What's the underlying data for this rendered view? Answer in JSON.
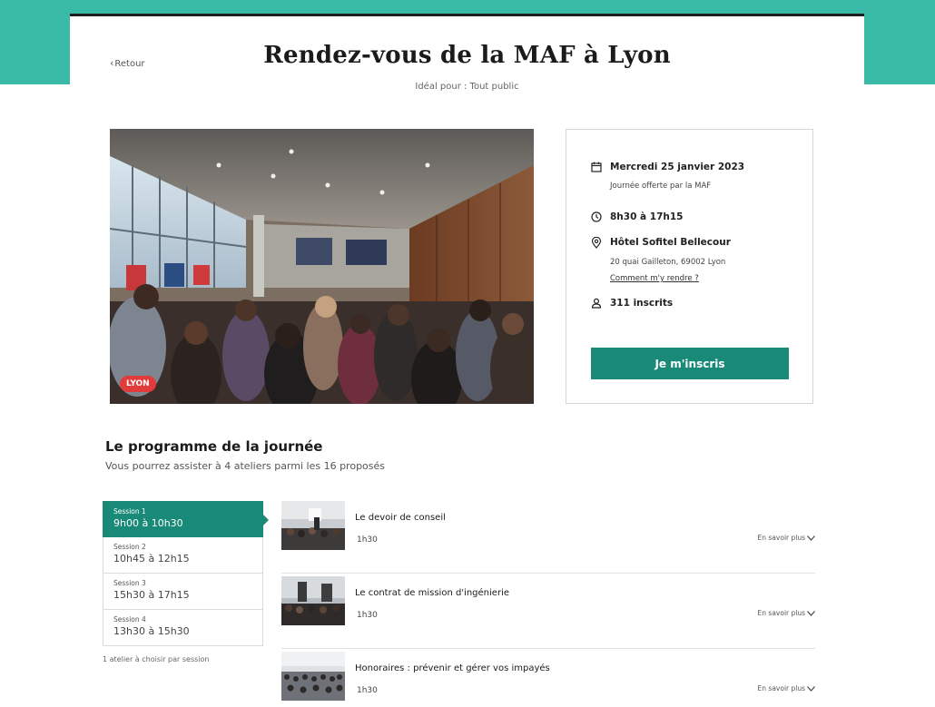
{
  "header": {
    "back_label": "Retour",
    "title": "Rendez-vous de la MAF à Lyon",
    "subtitle": "Idéal pour : Tout public"
  },
  "hero": {
    "city_badge": "LYON"
  },
  "event": {
    "date": "Mercredi 25 janvier 2023",
    "date_note": "Journée offerte par la MAF",
    "hours": "8h30 à 17h15",
    "venue": "Hôtel Sofitel Bellecour",
    "address": "20 quai Gailleton, 69002 Lyon",
    "directions_link": "Comment m'y rendre ?",
    "registered": "311 inscrits",
    "cta_label": "Je m'inscris"
  },
  "program": {
    "title": "Le programme de la journée",
    "subtitle": "Vous pourrez assister à 4 ateliers parmi les 16 proposés",
    "sessions": [
      {
        "label": "Session 1",
        "time": "9h00 à 10h30",
        "active": true
      },
      {
        "label": "Session 2",
        "time": "10h45 à 12h15",
        "active": false
      },
      {
        "label": "Session 3",
        "time": "15h30 à 17h15",
        "active": false
      },
      {
        "label": "Session 4",
        "time": "13h30 à 15h30",
        "active": false
      }
    ],
    "sessions_note": "1 atelier à choisir par session",
    "workshops": [
      {
        "title": "Le devoir de conseil",
        "duration": "1h30",
        "more": "En savoir plus"
      },
      {
        "title": "Le contrat de mission d'ingénierie",
        "duration": "1h30",
        "more": "En savoir plus"
      },
      {
        "title": "Honoraires : prévenir et gérer vos impayés",
        "duration": "1h30",
        "more": "En savoir plus"
      }
    ]
  },
  "colors": {
    "brand_teal": "#39bba8",
    "primary_green": "#1a8a78",
    "badge_red": "#e23b3b"
  },
  "icons": {
    "back": "chevron-left-icon",
    "date": "calendar-icon",
    "hours": "clock-icon",
    "venue": "location-pin-icon",
    "registered": "user-icon",
    "more": "chevron-down-icon"
  }
}
